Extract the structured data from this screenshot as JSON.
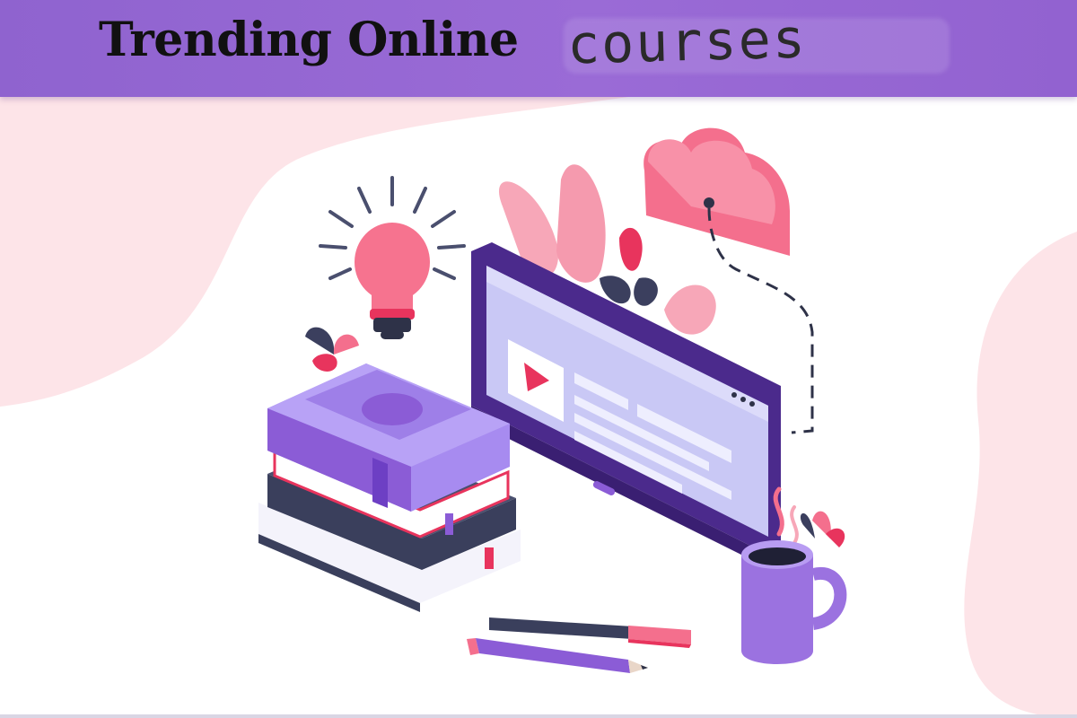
{
  "banner": {
    "title_main": "Trending Online",
    "title_handwritten": "courses"
  },
  "colors": {
    "banner": "#9566d3",
    "pink_bg": "#fde4e8",
    "purple": "#8b5cd6",
    "dark_purple": "#4b2a8c",
    "pink": "#f06a8a",
    "navy": "#3a3f5c"
  },
  "icons": [
    "lightbulb-icon",
    "cloud-icon",
    "monitor-icon",
    "play-icon",
    "books-icon",
    "coffee-mug-icon",
    "pen-icon",
    "pencil-icon",
    "leaf-icon"
  ]
}
